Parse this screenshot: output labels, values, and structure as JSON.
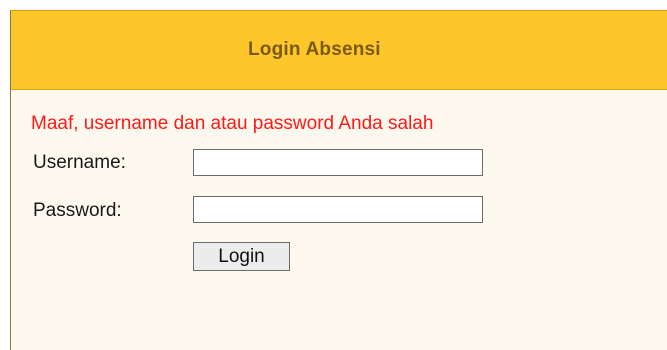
{
  "header": {
    "title": "Login Absensi"
  },
  "form": {
    "error_message": "Maaf, username dan atau password Anda salah",
    "username_label": "Username:",
    "username_value": "",
    "password_label": "Password:",
    "password_value": "",
    "login_button": "Login"
  },
  "colors": {
    "header_bg": "#fdc72c",
    "header_text": "#7a5a14",
    "error_text": "#ff1a1a",
    "panel_bg": "#fdf9ee"
  }
}
